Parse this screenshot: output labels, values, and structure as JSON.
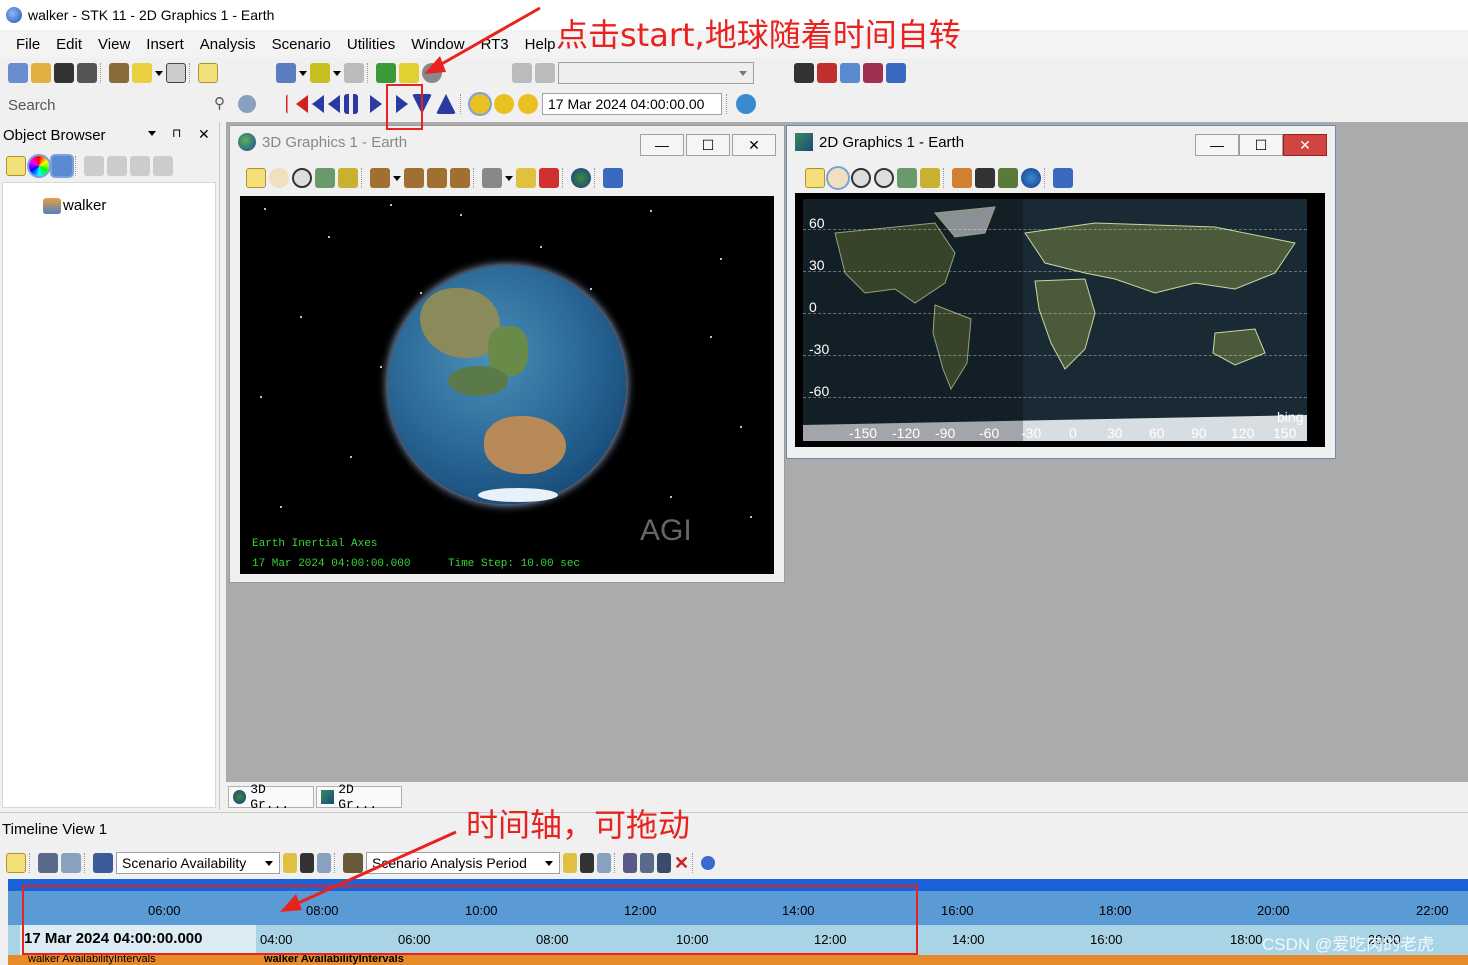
{
  "window": {
    "title": "walker - STK 11 - 2D Graphics 1 - Earth"
  },
  "menu": [
    "File",
    "Edit",
    "View",
    "Insert",
    "Analysis",
    "Scenario",
    "Utilities",
    "Window",
    "RT3",
    "Help"
  ],
  "toolbar": {
    "search_placeholder": "Search",
    "animation_time": "17 Mar 2024 04:00:00.00",
    "start_button_icon": "play-icon"
  },
  "object_browser": {
    "title": "Object Browser",
    "pin_icon": "pin-icon",
    "close_label": "✕",
    "tree": [
      {
        "label": "walker",
        "icon": "scenario-icon"
      }
    ]
  },
  "windows": {
    "graphics3d": {
      "title": "3D Graphics 1 - Earth",
      "overlay_axes": "Earth Inertial Axes",
      "overlay_time": "17 Mar 2024 04:00:00.000",
      "overlay_step": "Time Step: 10.00 sec",
      "watermark": "AGI"
    },
    "graphics2d": {
      "title": "2D Graphics 1 - Earth",
      "lat_ticks": [
        "60",
        "30",
        "0",
        "-30",
        "-60"
      ],
      "lon_ticks": [
        "-150",
        "-120",
        "-90",
        "-60",
        "-30",
        "0",
        "30",
        "60",
        "90",
        "120",
        "150"
      ],
      "watermark": "bing"
    }
  },
  "tabs": [
    {
      "label": "3D Gr...",
      "icon": "globe-icon"
    },
    {
      "label": "2D Gr...",
      "icon": "map-icon"
    }
  ],
  "timeline": {
    "title": "Timeline View 1",
    "scenario_combo": "Scenario Availability",
    "period_combo": "Scenario Analysis Period",
    "current_time": "17 Mar 2024 04:00:00.000",
    "major_ticks": [
      "06:00",
      "08:00",
      "10:00",
      "12:00",
      "14:00",
      "16:00",
      "18:00",
      "20:00",
      "22:00"
    ],
    "minor_ticks": [
      "04:00",
      "06:00",
      "08:00",
      "10:00",
      "12:00",
      "14:00",
      "16:00",
      "18:00",
      "20:00"
    ],
    "row_label_left": "walker AvailabilityIntervals",
    "row_label_right": "walker AvailabilityIntervals"
  },
  "annotations": {
    "start_note": "点击start,地球随着时间自转",
    "timeline_note": "时间轴，可拖动"
  },
  "watermark": "CSDN @爱吃肉的老虎",
  "colors": {
    "accent_red": "#e8231f",
    "timeline_blue": "#1a62d8",
    "timeline_axis": "#5b9bd5",
    "timeline_light": "#a9d4e6",
    "overlay_green": "#3bd23b"
  }
}
